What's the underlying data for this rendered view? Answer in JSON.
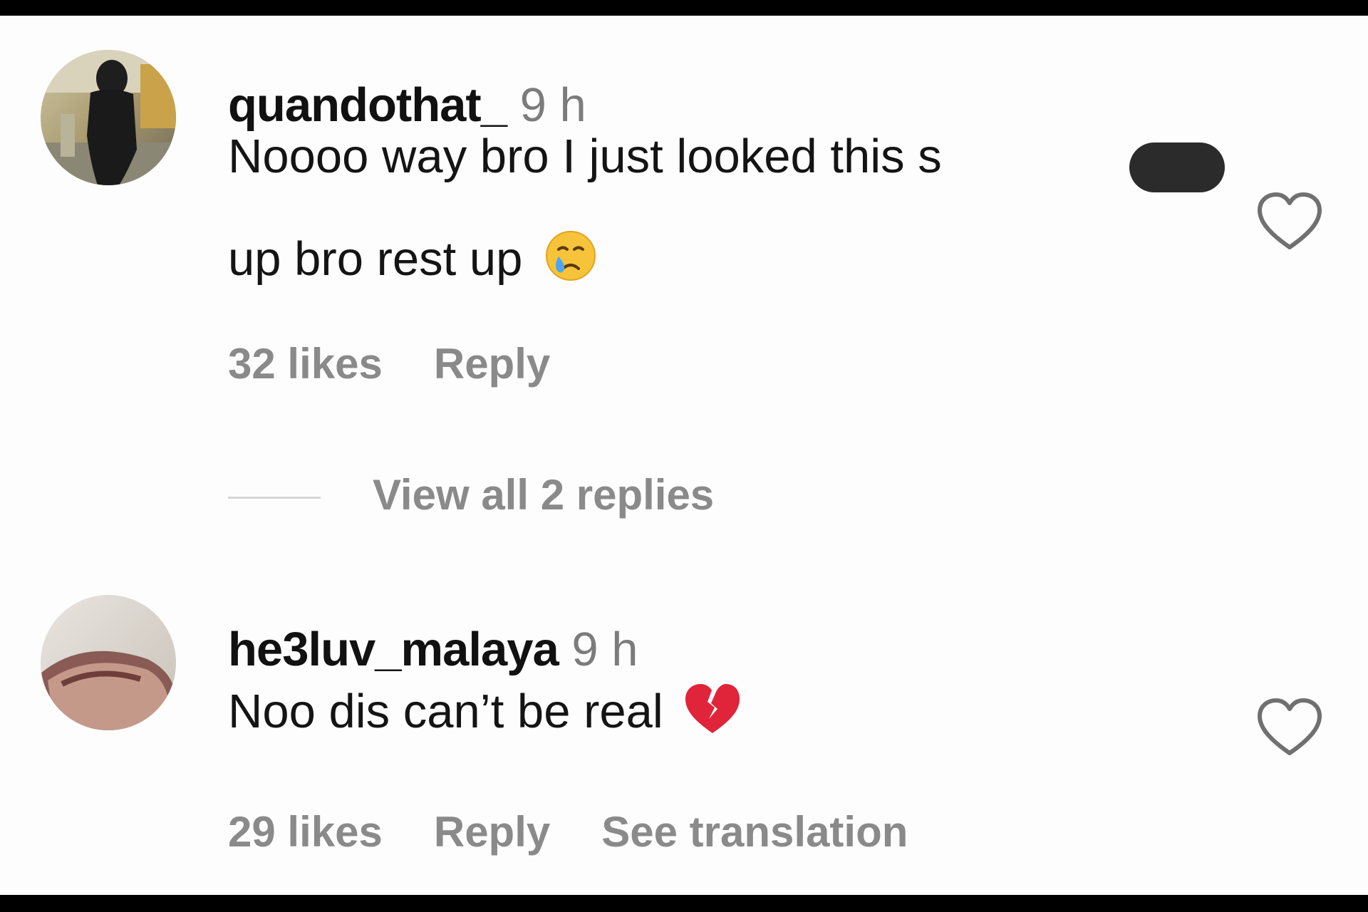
{
  "comments": [
    {
      "username": "quandothat_",
      "time": "9 h",
      "text_line1": "Noooo way bro I just looked this s",
      "text_line2": "up bro rest up",
      "emoji": "crying-face",
      "likes": "32 likes",
      "reply_label": "Reply"
    },
    {
      "username": "he3luv_malaya",
      "time": "9 h",
      "text": "Noo dis can’t be real",
      "emoji": "broken-heart",
      "likes": "29 likes",
      "reply_label": "Reply",
      "translation_label": "See translation"
    }
  ],
  "replies": {
    "view_label": "View all 2 replies"
  },
  "colors": {
    "background": "#fdfdfd",
    "username": "#111111",
    "secondary_text": "#8a8a8a",
    "frame": "#000000",
    "redaction": "#2b2b2b"
  }
}
